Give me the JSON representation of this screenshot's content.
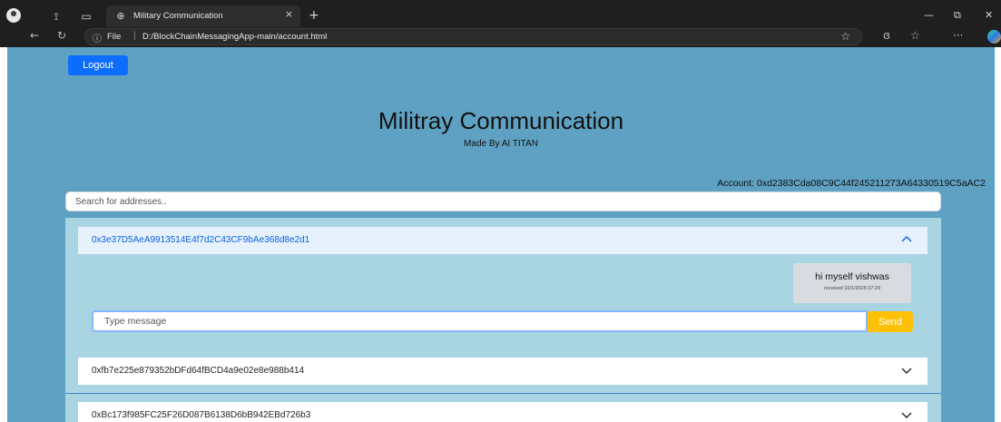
{
  "browser": {
    "tab_title": "Military Communication",
    "tab_close": "×",
    "new_tab": "+",
    "address_label": "File",
    "address_separator": "|",
    "url": "D:/BlockChainMessagingApp-main/account.html",
    "window_controls": {
      "minimize": "—",
      "restore": "⧉",
      "close": "✕"
    }
  },
  "page": {
    "logout_label": "Logout",
    "title": "Militray Communication",
    "subtitle": "Made By AI TITAN",
    "account": "Account: 0xd2383Cda08C9C44f245211273A64330519C5aAC2",
    "search_placeholder": "Search for addresses.."
  },
  "conversations": [
    {
      "address": "0x3e37D5AeA9913514E4f7d2C43CF9bAe368d8e2d1",
      "expanded": true,
      "messages": [
        {
          "text": "hi myself vishwas",
          "meta": "received 10/1/2025 07:29"
        }
      ],
      "input_placeholder": "Type message",
      "send_label": "Send"
    },
    {
      "address": "0xfb7e225e879352bDFd64fBCD4a9e02e8e988b414",
      "expanded": false
    },
    {
      "address": "0xBc173f985FC25F26D087B6138D6bB942EBd726b3",
      "expanded": false
    }
  ],
  "colors": {
    "page_bg": "#5fa1c2",
    "accordion_bg": "#a9d5e3",
    "logout": "#0d6efd",
    "send": "#ffc107",
    "open_header_text": "#0c63e4"
  }
}
